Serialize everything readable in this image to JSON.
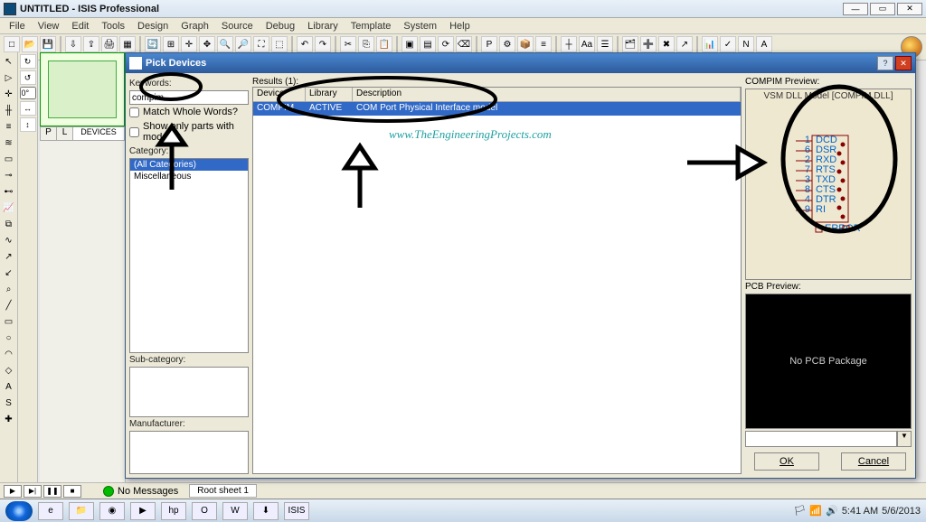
{
  "window": {
    "title": "UNTITLED - ISIS Professional"
  },
  "menu": [
    "File",
    "View",
    "Edit",
    "Tools",
    "Design",
    "Graph",
    "Source",
    "Debug",
    "Library",
    "Template",
    "System",
    "Help"
  ],
  "design_panel": {
    "p": "P",
    "l": "L",
    "devices": "DEVICES"
  },
  "dialog": {
    "title": "Pick Devices",
    "keywords_label": "Keywords:",
    "keywords_value": "compim",
    "match_whole": "Match Whole Words?",
    "show_models": "Show only parts with models?",
    "category_label": "Category:",
    "categories": [
      "(All Categories)",
      "Miscellaneous"
    ],
    "subcat_label": "Sub-category:",
    "manuf_label": "Manufacturer:",
    "results_label": "Results (1):",
    "cols": {
      "c1": "Device",
      "c2": "Library",
      "c3": "Description"
    },
    "row": {
      "device": "COMPIM",
      "library": "ACTIVE",
      "desc": "COM Port Physical Interface model"
    },
    "watermark": "www.TheEngineeringProjects.com",
    "preview_label": "COMPIM Preview:",
    "preview_title": "VSM DLL Model [COMPIM.DLL]",
    "pcb_label": "PCB Preview:",
    "pcb_text": "No PCB Package",
    "ok": "OK",
    "cancel": "Cancel"
  },
  "compim_pins": [
    "DCD",
    "DSR",
    "RXD",
    "RTS",
    "TXD",
    "CTS",
    "DTR",
    "RI"
  ],
  "compim_error": "ERROR",
  "status": {
    "nomsg": "No Messages",
    "sheet": "Root sheet 1"
  },
  "tray": {
    "time": "5:41 AM",
    "date": "5/6/2013"
  },
  "rot": {
    "deg": "0°"
  }
}
